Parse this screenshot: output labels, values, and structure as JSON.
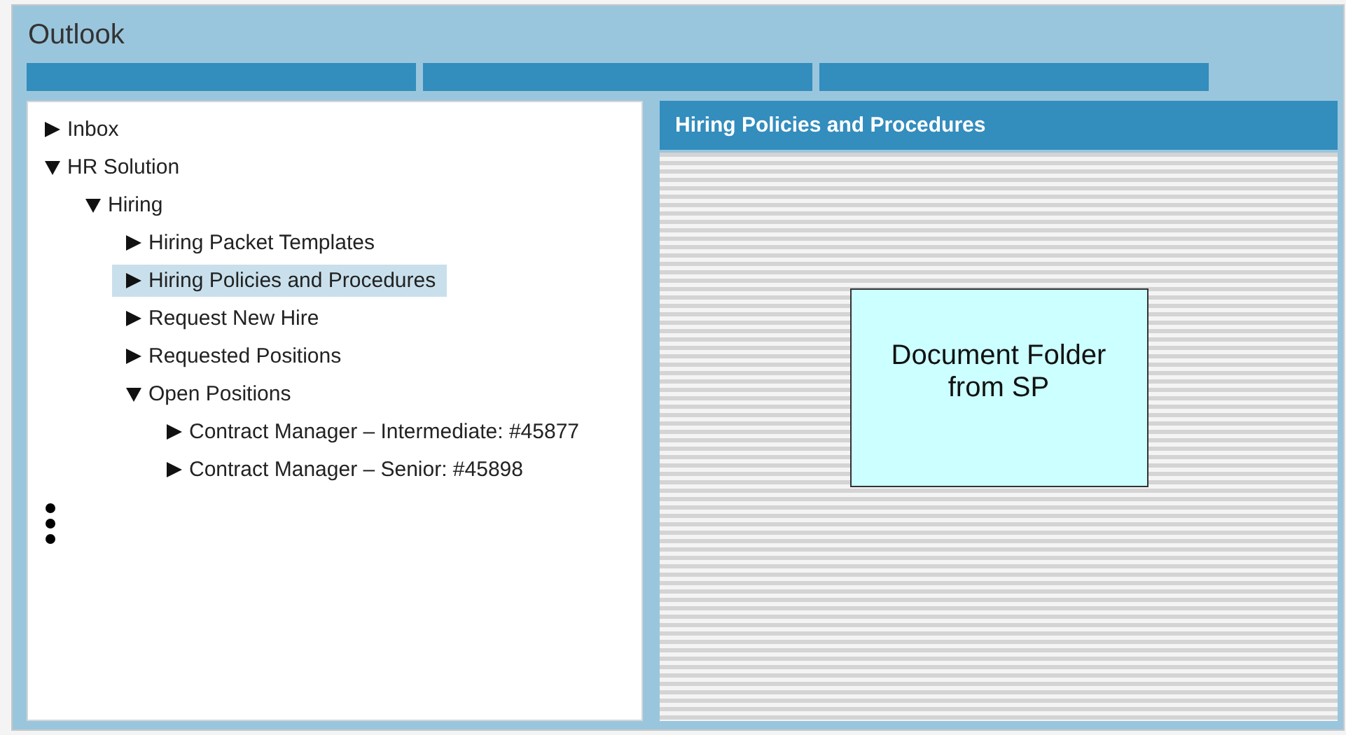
{
  "window": {
    "title": "Outlook"
  },
  "tree": [
    {
      "label": "Inbox",
      "expanded": false,
      "selected": false
    },
    {
      "label": "HR Solution",
      "expanded": true,
      "selected": false,
      "children": [
        {
          "label": "Hiring",
          "expanded": true,
          "selected": false,
          "children": [
            {
              "label": "Hiring Packet Templates",
              "expanded": false,
              "selected": false
            },
            {
              "label": "Hiring Policies and Procedures",
              "expanded": false,
              "selected": true
            },
            {
              "label": "Request New Hire",
              "expanded": false,
              "selected": false
            },
            {
              "label": "Requested Positions",
              "expanded": false,
              "selected": false
            },
            {
              "label": "Open Positions",
              "expanded": true,
              "selected": false,
              "children": [
                {
                  "label": "Contract Manager – Intermediate: #45877",
                  "expanded": false,
                  "selected": false
                },
                {
                  "label": "Contract Manager – Senior: #45898",
                  "expanded": false,
                  "selected": false
                }
              ]
            }
          ]
        }
      ]
    }
  ],
  "content": {
    "title": "Hiring Policies and Procedures",
    "placeholder_box": "Document Folder\nfrom SP"
  }
}
